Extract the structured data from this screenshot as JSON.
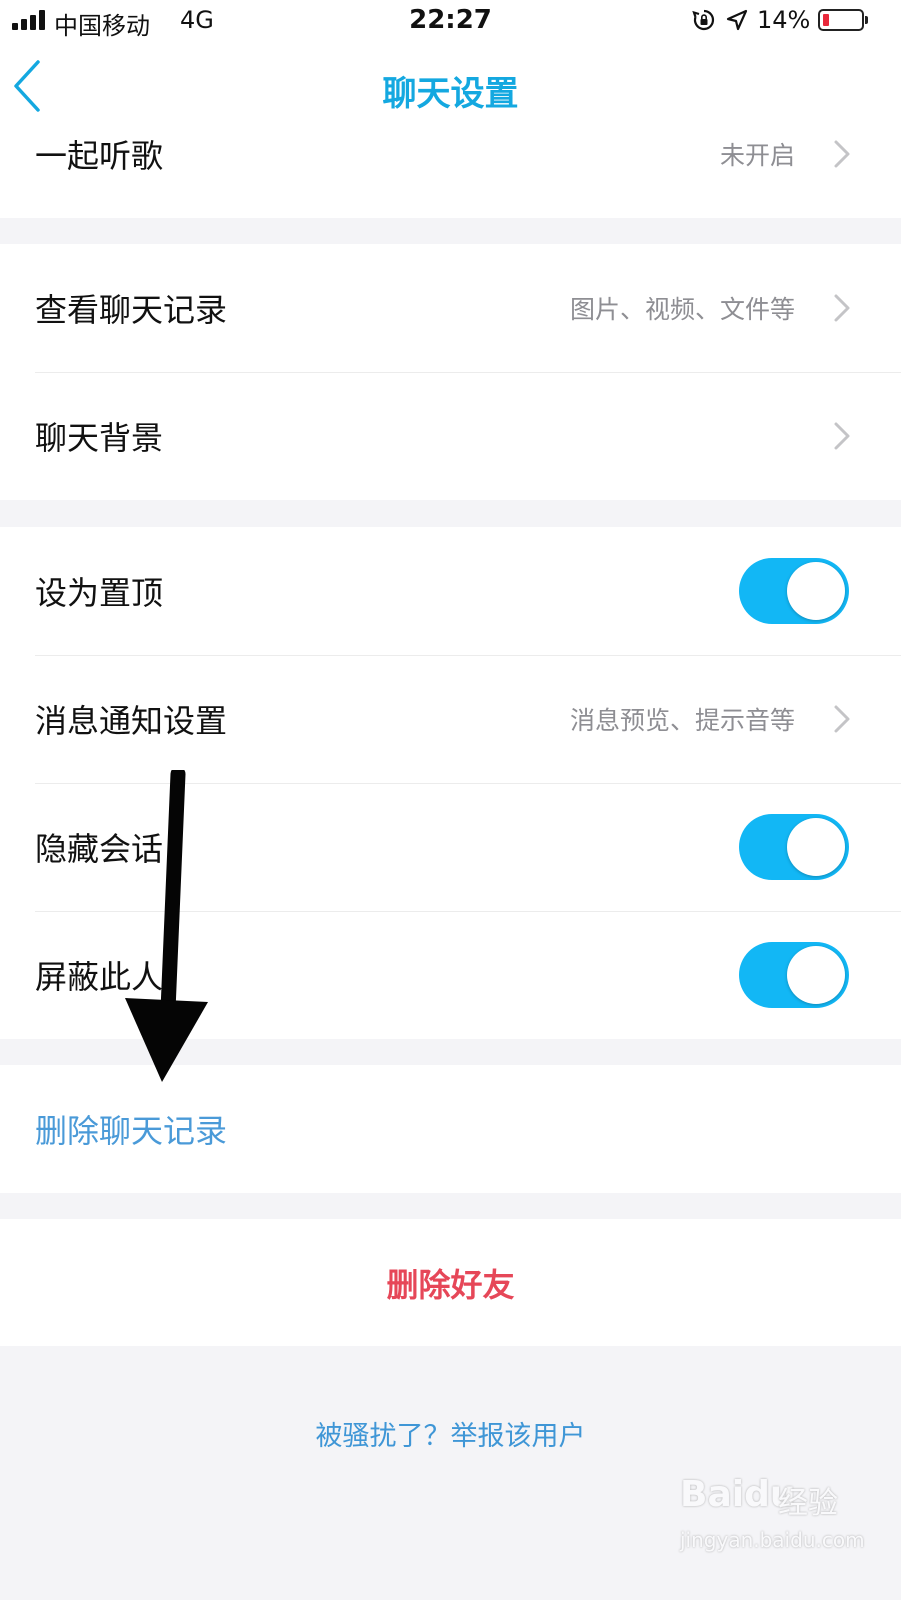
{
  "status_bar": {
    "carrier": "中国移动",
    "network": "4G",
    "time": "22:27",
    "battery_percent": "14%",
    "battery_color": "#e8283b",
    "icons": [
      "signal-icon",
      "orientation-lock-icon",
      "location-icon",
      "battery-icon"
    ]
  },
  "nav": {
    "title": "聊天设置",
    "back_icon": "chevron-left-icon",
    "accent_color": "#14a8e0"
  },
  "settings": {
    "listen_together": {
      "label": "一起听歌",
      "value": "未开启"
    },
    "view_history": {
      "label": "查看聊天记录",
      "value": "图片、视频、文件等"
    },
    "chat_background": {
      "label": "聊天背景"
    },
    "pin_top": {
      "label": "设为置顶",
      "toggle_on": true
    },
    "notification_settings": {
      "label": "消息通知设置",
      "value": "消息预览、提示音等"
    },
    "hide_conversation": {
      "label": "隐藏会话",
      "toggle_on": true
    },
    "block_user": {
      "label": "屏蔽此人",
      "toggle_on": true
    },
    "toggle_color": "#12b7f5"
  },
  "actions": {
    "delete_history": "删除聊天记录",
    "delete_friend": "删除好友",
    "report": "被骚扰了？举报该用户",
    "delete_friend_color": "#e64758"
  },
  "watermark": {
    "logo": "Baidu",
    "jingyan": "经验",
    "url": "jingyan.baidu.com"
  }
}
